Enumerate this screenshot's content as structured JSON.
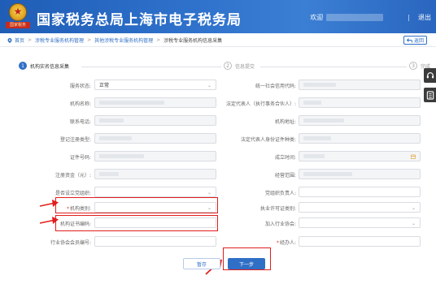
{
  "header": {
    "title": "国家税务总局上海市电子税务局",
    "emblem_text": "国家税务",
    "welcome": "欢迎",
    "separator": "|",
    "logout": "退出"
  },
  "breadcrumb": {
    "items": [
      "首页",
      "涉税专业服务机构管理",
      "其他涉税专业服务机构管理",
      "涉税专业服务机构信息采集"
    ],
    "back_label": "返回"
  },
  "steps": [
    {
      "num": "1",
      "label": "机构实名信息采集",
      "state": "active"
    },
    {
      "num": "2",
      "label": "信息提交",
      "state": "todo"
    },
    {
      "num": "3",
      "label": "完成",
      "state": "todo"
    }
  ],
  "form": {
    "left": [
      {
        "label": "服务状态:",
        "value": "正常",
        "type": "select-dark",
        "required": false
      },
      {
        "label": "机构名称:",
        "value": "",
        "type": "disabled",
        "required": false
      },
      {
        "label": "联系电话:",
        "value": "",
        "type": "disabled",
        "required": false
      },
      {
        "label": "登记注册类型:",
        "value": "",
        "type": "disabled",
        "required": false
      },
      {
        "label": "证件号码:",
        "value": "",
        "type": "disabled",
        "required": false
      },
      {
        "label": "注册资金（元）:",
        "value": "",
        "type": "disabled",
        "required": false
      },
      {
        "label": "是否设立党组织:",
        "value": "",
        "type": "select",
        "required": false
      },
      {
        "label": "机构类别:",
        "value": "",
        "type": "select",
        "required": true
      },
      {
        "label": "机构证书编码:",
        "value": "",
        "type": "text",
        "required": false
      },
      {
        "label": "行业协会会员编号:",
        "value": "",
        "type": "text",
        "required": false
      }
    ],
    "right": [
      {
        "label": "统一社会信用代码:",
        "value": "",
        "type": "disabled",
        "required": false
      },
      {
        "label": "法定代表人（执行事务合伙人）:",
        "value": "",
        "type": "disabled",
        "required": false
      },
      {
        "label": "机构地址:",
        "value": "",
        "type": "disabled",
        "required": false
      },
      {
        "label": "法定代表人身份证件种类:",
        "value": "",
        "type": "disabled",
        "required": false
      },
      {
        "label": "成立时间:",
        "value": "",
        "type": "date",
        "required": false
      },
      {
        "label": "经营范围:",
        "value": "",
        "type": "disabled",
        "required": false
      },
      {
        "label": "党组织负责人:",
        "value": "",
        "type": "text",
        "required": false
      },
      {
        "label": "执业许可证类别:",
        "value": "",
        "type": "select",
        "required": false
      },
      {
        "label": "加入行业协会:",
        "value": "",
        "type": "select",
        "required": false
      },
      {
        "label": "经办人:",
        "value": "",
        "type": "text",
        "required": true
      }
    ]
  },
  "buttons": {
    "save": "暂存",
    "next": "下一步"
  },
  "colors": {
    "brand_blue": "#2f6fc6",
    "highlight_red": "#e21d1d"
  },
  "icons": [
    "location-pin-icon",
    "back-arrow-icon",
    "headset-icon",
    "notebook-icon",
    "calendar-icon",
    "chevron-down-icon"
  ]
}
